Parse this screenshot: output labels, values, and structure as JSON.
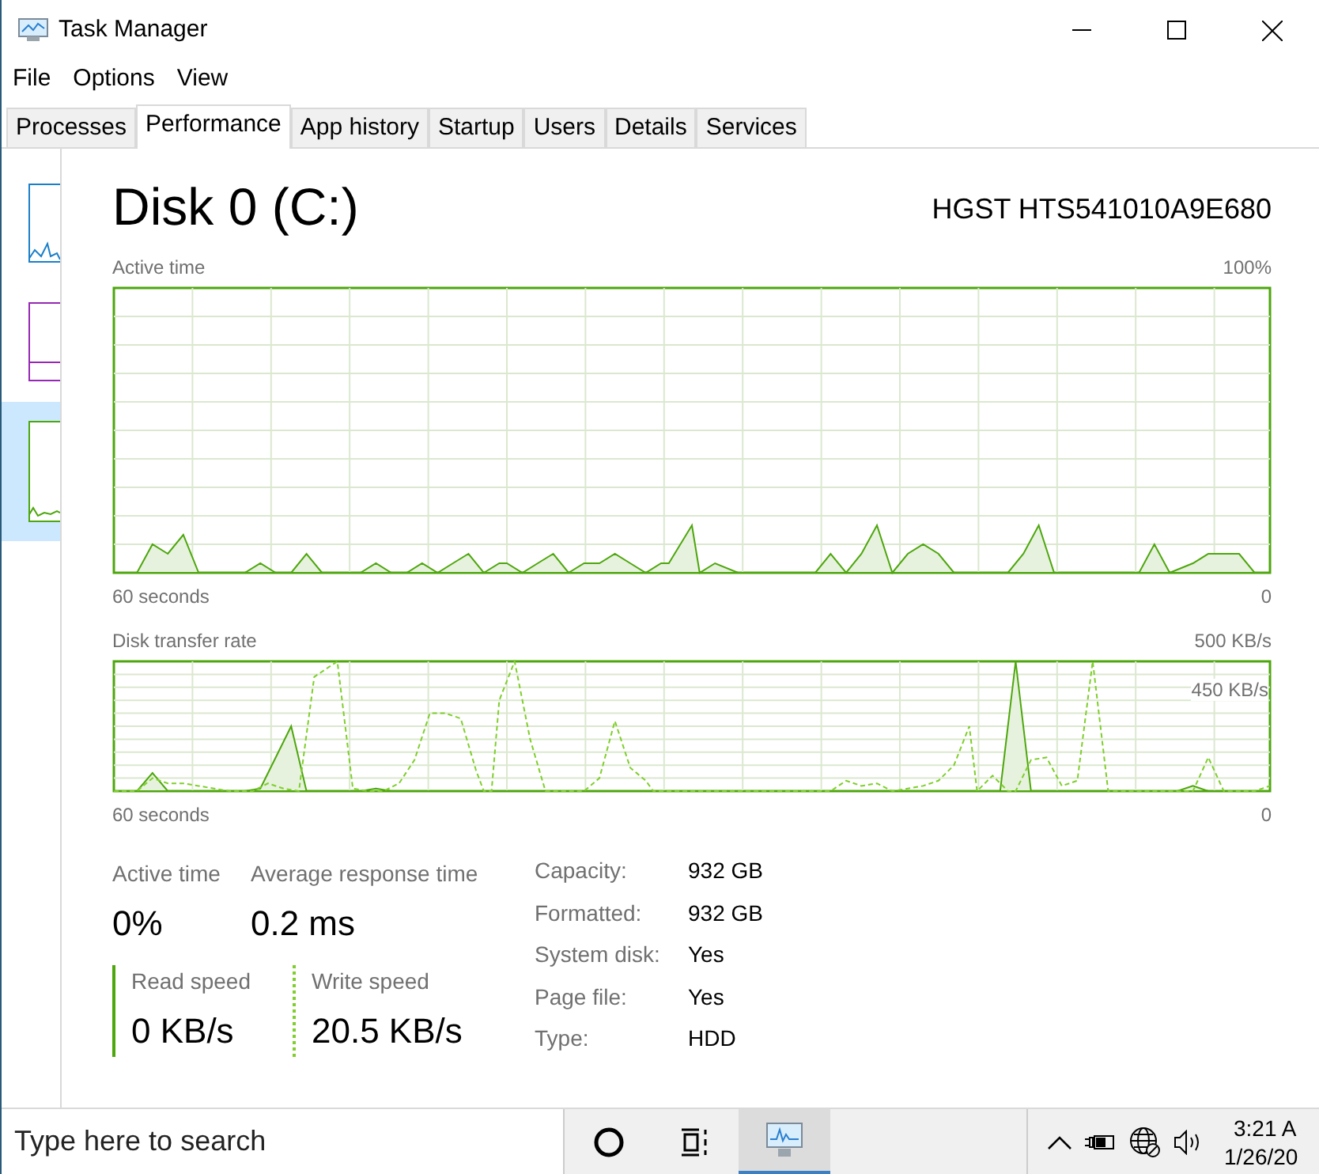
{
  "window": {
    "title": "Task Manager"
  },
  "menu": [
    "File",
    "Options",
    "View"
  ],
  "tabs": [
    {
      "label": "Processes",
      "selected": false
    },
    {
      "label": "Performance",
      "selected": true
    },
    {
      "label": "App history",
      "selected": false
    },
    {
      "label": "Startup",
      "selected": false
    },
    {
      "label": "Users",
      "selected": false
    },
    {
      "label": "Details",
      "selected": false
    },
    {
      "label": "Services",
      "selected": false
    }
  ],
  "sidebar": {
    "items": [
      {
        "color": "#1a7fc9",
        "selected": false
      },
      {
        "color": "#9528b4",
        "selected": false
      },
      {
        "color": "#4da60c",
        "selected": true
      }
    ]
  },
  "header": {
    "title": "Disk 0 (C:)",
    "model": "HGST HTS541010A9E680"
  },
  "active_time_graph": {
    "label": "Active time",
    "max": "100%",
    "span": "60 seconds",
    "min": "0"
  },
  "transfer_graph": {
    "label": "Disk transfer rate",
    "max": "500 KB/s",
    "mark": "450 KB/s",
    "span": "60 seconds",
    "min": "0"
  },
  "stats": [
    {
      "label": "Active time",
      "value": "0%"
    },
    {
      "label": "Average response time",
      "value": "0.2 ms"
    }
  ],
  "speeds": [
    {
      "label": "Read speed",
      "value": "0 KB/s",
      "kind": "solid"
    },
    {
      "label": "Write speed",
      "value": "20.5 KB/s",
      "kind": "dashed"
    }
  ],
  "properties": [
    {
      "label": "Capacity:",
      "value": "932 GB"
    },
    {
      "label": "Formatted:",
      "value": "932 GB"
    },
    {
      "label": "System disk:",
      "value": "Yes"
    },
    {
      "label": "Page file:",
      "value": "Yes"
    },
    {
      "label": "Type:",
      "value": "HDD"
    }
  ],
  "taskbar": {
    "search": {
      "placeholder": "Type here to search"
    },
    "time": "3:21 A",
    "date": "1/26/20"
  }
}
